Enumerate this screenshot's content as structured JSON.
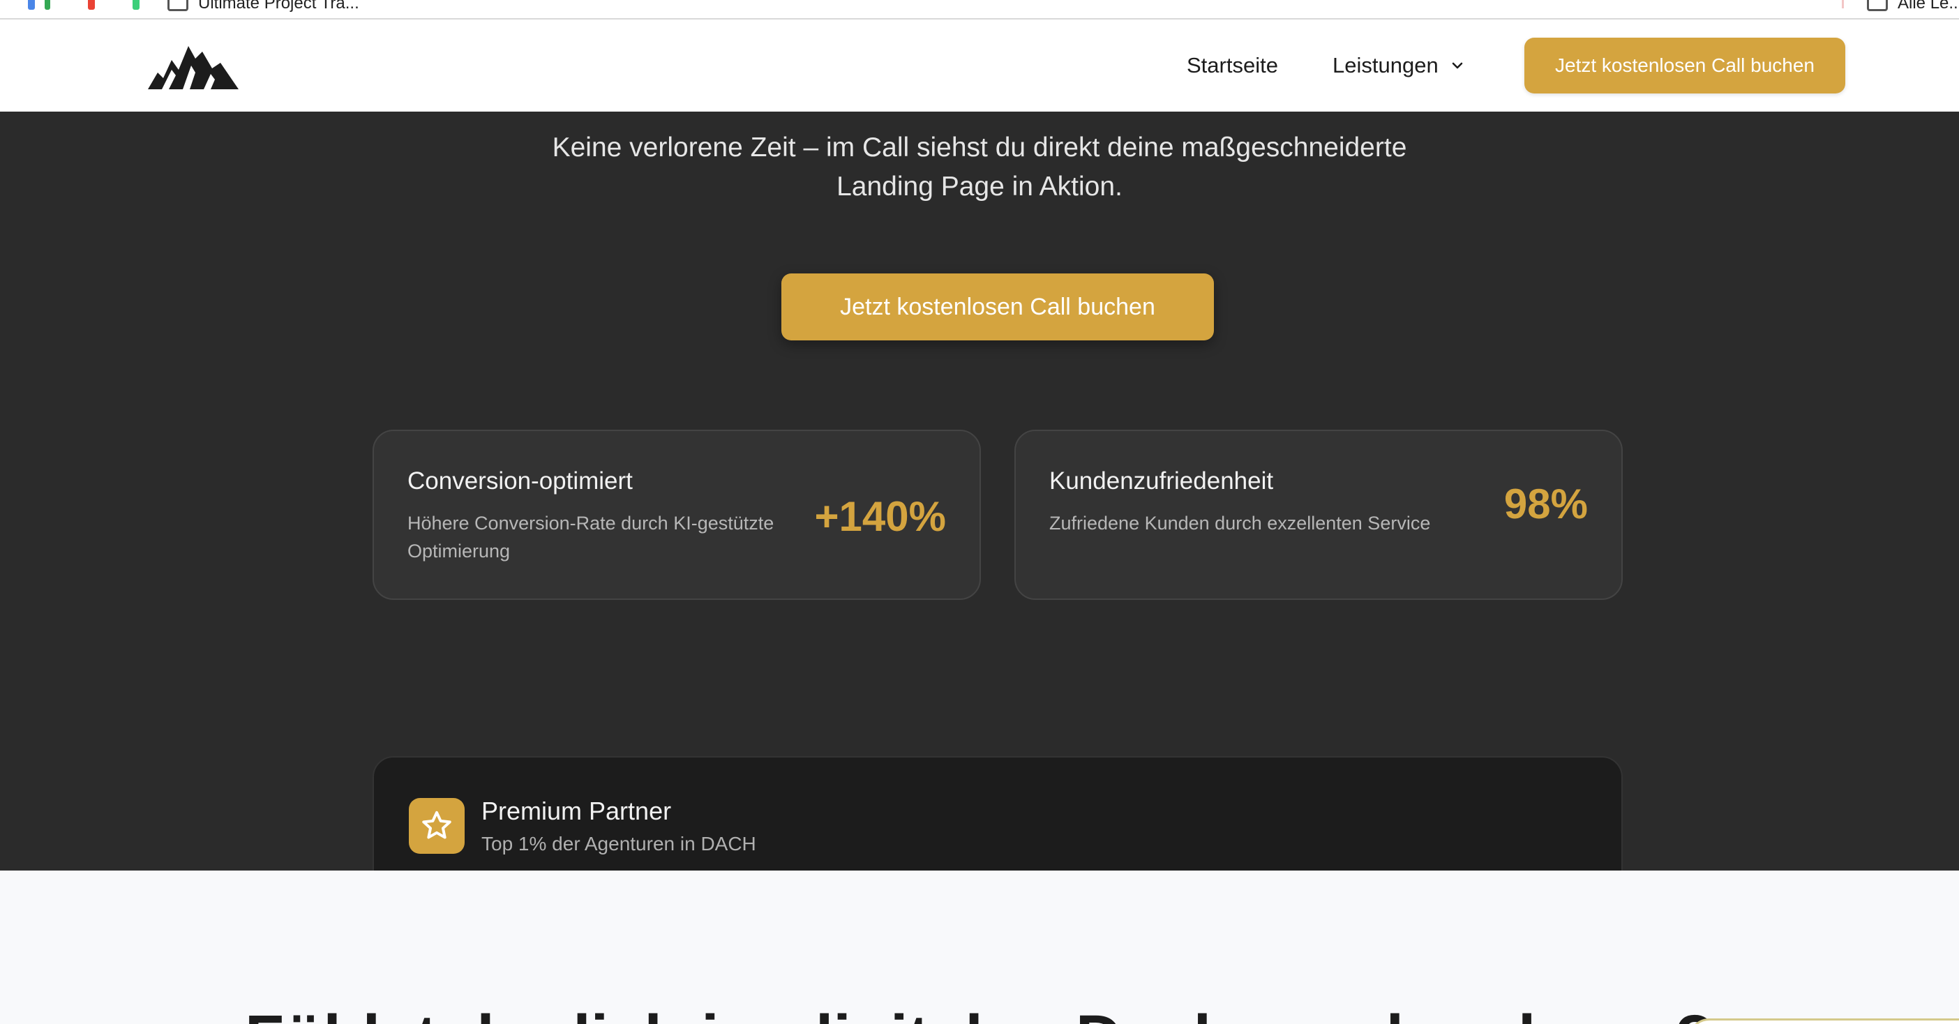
{
  "browser": {
    "bookmark_tab": "Ultimate Project Tra...",
    "bookmark_right": "Alle Le..."
  },
  "nav": {
    "home": "Startseite",
    "services": "Leistungen",
    "cta": "Jetzt kostenlosen Call buchen"
  },
  "hero": {
    "subtitle_line1": "Keine verlorene Zeit – im Call siehst du direkt deine maßgeschneiderte",
    "subtitle_line2": "Landing Page in Aktion.",
    "cta": "Jetzt kostenlosen Call buchen"
  },
  "stats": [
    {
      "title": "Conversion-optimiert",
      "description": "Höhere Conversion-Rate durch KI-gestützte Optimierung",
      "value": "+140%"
    },
    {
      "title": "Kundenzufriedenheit",
      "description": "Zufriedene Kunden durch exzellenten Service",
      "value": "98%"
    }
  ],
  "partner": {
    "title": "Premium Partner",
    "subtitle": "Top 1% der Agenturen in DACH"
  },
  "section2": {
    "heading": "Fühlst du dich im digitalen Dschungel verloren?"
  },
  "colors": {
    "accent": "#d4a43f",
    "dark_bg": "#2b2b2b",
    "card_bg": "#333333",
    "partner_bg": "#1c1c1c",
    "light_bg": "#f8f9fb"
  },
  "icons": {
    "logo": "mountain-logo-icon",
    "chevron": "chevron-down-icon",
    "star": "star-icon"
  }
}
